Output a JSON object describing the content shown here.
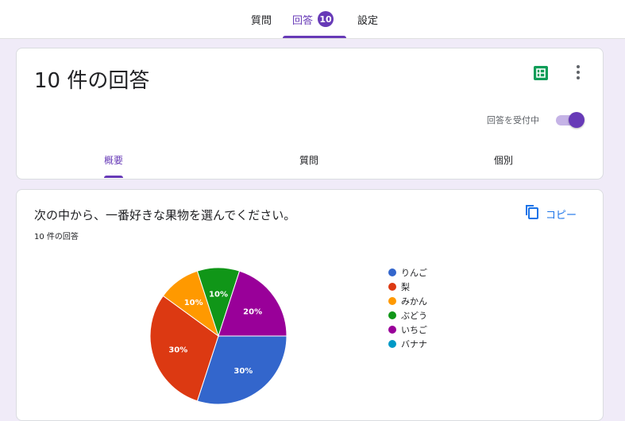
{
  "top_tabs": {
    "questions": "質問",
    "responses": "回答",
    "responses_badge": "10",
    "settings": "設定"
  },
  "summary_card": {
    "title": "10 件の回答",
    "sheets_icon": "sheets-icon",
    "more_icon": "more-vert-icon",
    "accepting_label": "回答を受付中",
    "accepting": true,
    "subtabs": {
      "summary": "概要",
      "question": "質問",
      "individual": "個別"
    }
  },
  "question_card": {
    "title": "次の中から、一番好きな果物を選んでください。",
    "response_count": "10 件の回答",
    "copy_label": "コピー",
    "copy_icon": "copy-icon"
  },
  "colors": {
    "accent": "#673ab7",
    "link": "#1a73e8"
  },
  "chart_data": {
    "type": "pie",
    "categories": [
      "りんご",
      "梨",
      "みかん",
      "ぶどう",
      "いちご",
      "バナナ"
    ],
    "values": [
      30,
      30,
      10,
      10,
      20,
      0
    ],
    "labels": [
      "30%",
      "30%",
      "10%",
      "10%",
      "20%",
      ""
    ],
    "colors": [
      "#3366cc",
      "#dc3912",
      "#ff9900",
      "#109618",
      "#990099",
      "#0099c6"
    ],
    "legend": "right"
  }
}
